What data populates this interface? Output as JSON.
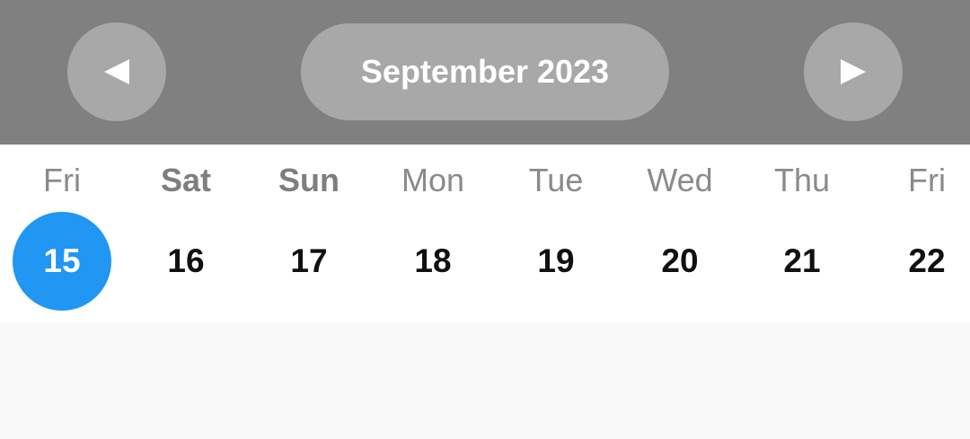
{
  "header": {
    "month_label": "September 2023",
    "prev_icon": "triangle-left-icon",
    "next_icon": "triangle-right-icon"
  },
  "colors": {
    "header_bg": "#808080",
    "button_bg": "#a8a8a8",
    "selected_bg": "#2196f3"
  },
  "days": [
    {
      "name": "Fri",
      "number": "15",
      "selected": true,
      "weekend": false
    },
    {
      "name": "Sat",
      "number": "16",
      "selected": false,
      "weekend": true
    },
    {
      "name": "Sun",
      "number": "17",
      "selected": false,
      "weekend": true
    },
    {
      "name": "Mon",
      "number": "18",
      "selected": false,
      "weekend": false
    },
    {
      "name": "Tue",
      "number": "19",
      "selected": false,
      "weekend": false
    },
    {
      "name": "Wed",
      "number": "20",
      "selected": false,
      "weekend": false
    },
    {
      "name": "Thu",
      "number": "21",
      "selected": false,
      "weekend": false
    },
    {
      "name": "Fri",
      "number": "22",
      "selected": false,
      "weekend": false
    }
  ]
}
